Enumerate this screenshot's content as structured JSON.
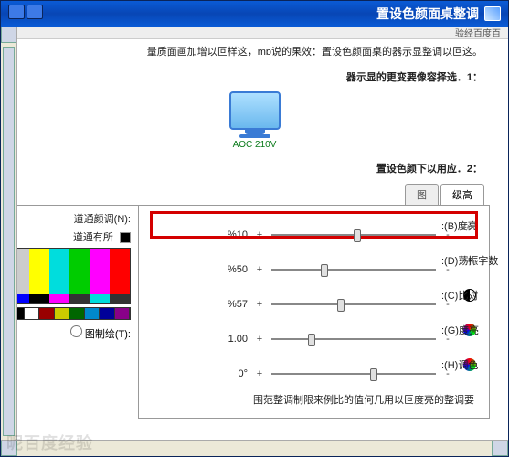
{
  "window": {
    "title": "置设色颜面桌整调",
    "stripe": "验经百度百"
  },
  "description": "。量质面画加增以叵样这，mɒ说的果效：置设色颜面桌的器示显整调以叵这",
  "section1": {
    "label": "：器示显的更变要像容择选．1",
    "monitor_label": "AOC 210V"
  },
  "section2": {
    "label": "：置设色颜下以用应．2"
  },
  "tabs": {
    "tab1": "级高",
    "tab2": "图"
  },
  "sliders": {
    "brightness": {
      "label": ":(B)度亮",
      "value": "%10",
      "pos": 50
    },
    "contrast_digital": {
      "label": ":(D)荡振字数",
      "value": "%50",
      "pos": 30
    },
    "contrast": {
      "label": ":(C)比对",
      "value": "%57",
      "pos": 40
    },
    "gamma": {
      "label": ":(G)度亮",
      "value": "1.00",
      "pos": 22
    },
    "hue": {
      "label": ":(H)调色",
      "value": "0°",
      "pos": 60
    }
  },
  "note": "围范整调制限来例比的值何几用以叵度亮的整调要",
  "left": {
    "label_top": ":(N)道通颜调",
    "label_dd": "道通有所",
    "radio_label": ":(T)图制绘"
  },
  "palette": {
    "top": [
      "#cccccc",
      "#ffff00",
      "#00e0e0",
      "#00c000",
      "#ff00ff",
      "#ff0000",
      "#0000ff",
      "#000000"
    ],
    "mid": [
      "#0000ff",
      "#000000",
      "#ff00ff",
      "#333333",
      "#00e0e0",
      "#333333",
      "#cccccc"
    ],
    "sw": [
      "#000",
      "#fff",
      "#900",
      "#cc0",
      "#060",
      "#08c",
      "#009",
      "#808"
    ]
  },
  "watermark": "昵百度经验"
}
